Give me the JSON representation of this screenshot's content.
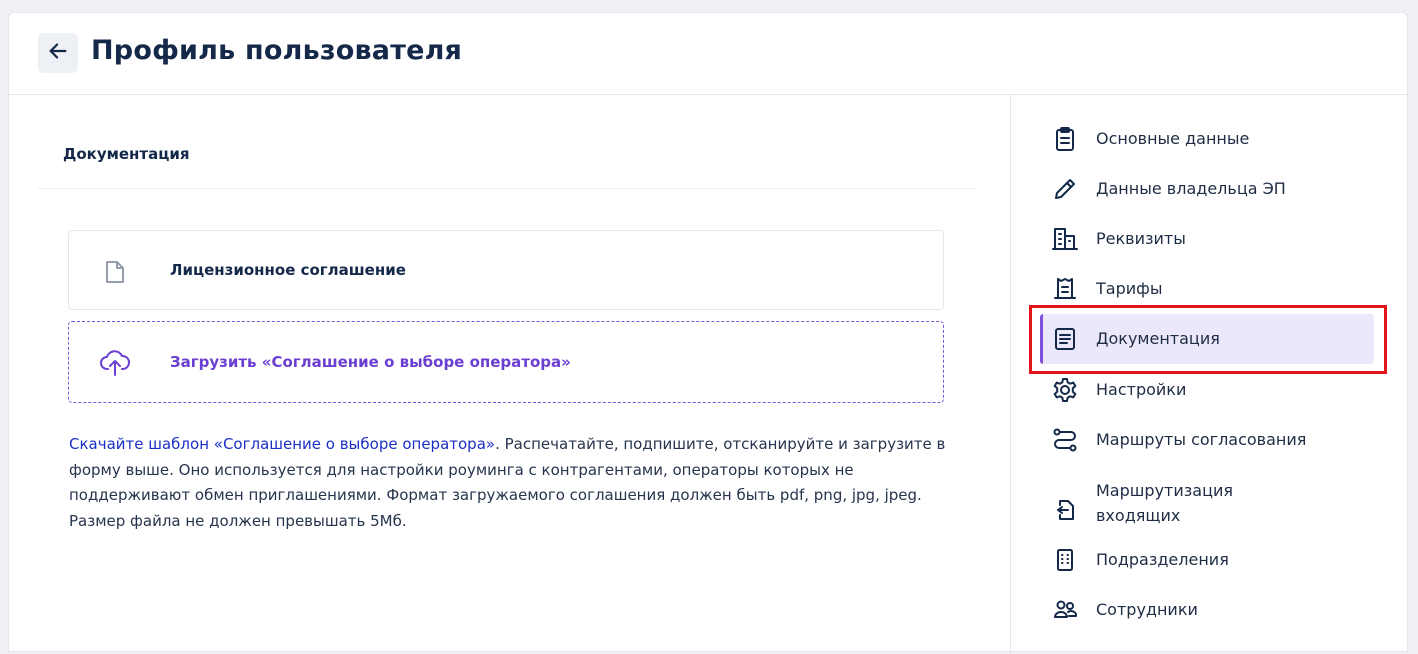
{
  "header": {
    "back_icon": "arrow-left-icon",
    "title": "Профиль пользователя"
  },
  "main": {
    "section_title": "Документация",
    "documents": [
      {
        "icon": "file-icon",
        "label": "Лицензионное соглашение"
      }
    ],
    "upload": {
      "icon": "cloud-upload-icon",
      "label": "Загрузить «Соглашение о выборе оператора»"
    },
    "hint": {
      "link_text": "Скачайте шаблон «Соглашение о выборе оператора»",
      "text": ". Распечатайте, подпишите, отсканируйте и загрузите в форму выше. Оно используется для настройки роуминга с контрагентами, операторы которых не поддерживают обмен приглашениями. Формат загружаемого соглашения должен быть pdf, png, jpg, jpeg. Размер файла не должен превышать 5Мб."
    }
  },
  "sidebar": {
    "items": [
      {
        "label": "Основные данные",
        "icon": "clipboard-icon"
      },
      {
        "label": "Данные владельца ЭП",
        "icon": "pencil-icon"
      },
      {
        "label": "Реквизиты",
        "icon": "building-icon"
      },
      {
        "label": "Тарифы",
        "icon": "receipt-icon"
      },
      {
        "label": "Документация",
        "icon": "document-list-icon",
        "active": true
      },
      {
        "label": "Настройки",
        "icon": "gear-icon"
      },
      {
        "label": "Маршруты согласования",
        "icon": "route-icon"
      },
      {
        "label": "Маршрутизация входящих",
        "icon": "incoming-doc-icon"
      },
      {
        "label": "Подразделения",
        "icon": "office-building-icon"
      },
      {
        "label": "Сотрудники",
        "icon": "users-icon"
      }
    ]
  },
  "colors": {
    "accent": "#7b54d9",
    "accent_text": "#6b3fd1",
    "active_bg": "#ece8fb",
    "link": "#1a2fc7",
    "highlight": "#e0161a",
    "title": "#14294a"
  }
}
